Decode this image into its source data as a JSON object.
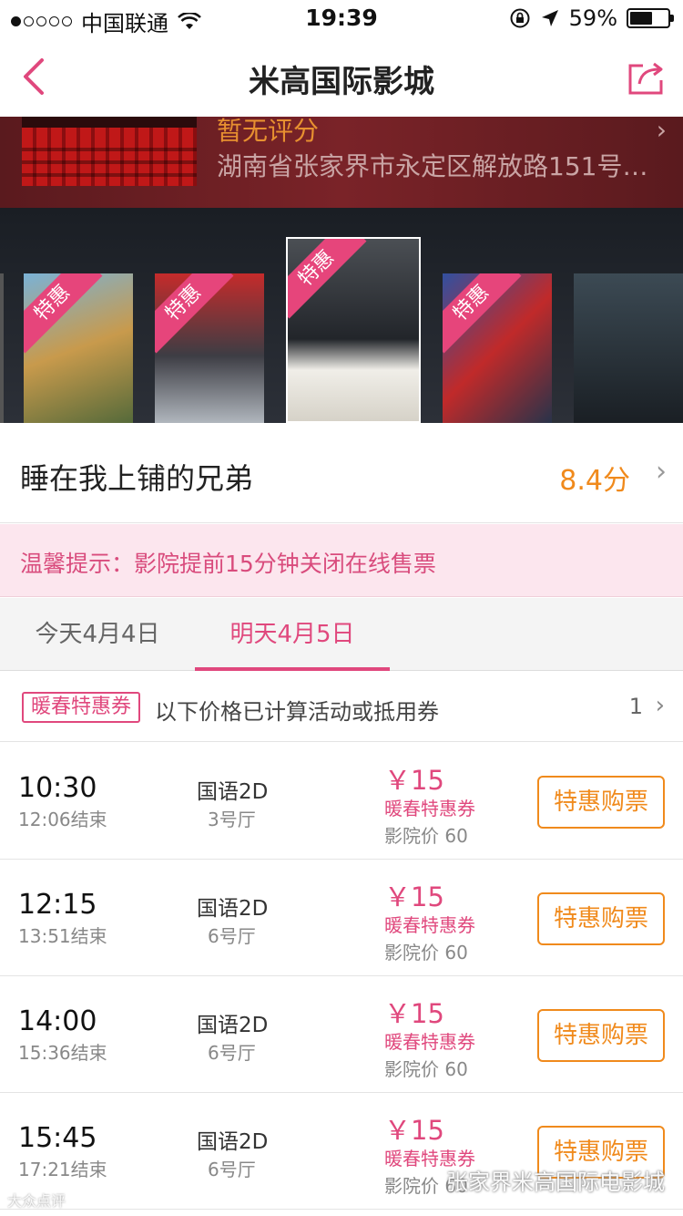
{
  "status_bar": {
    "carrier": "中国联通",
    "time": "19:39",
    "battery": "59%",
    "battery_level": 0.59
  },
  "nav": {
    "title": "米高国际影城",
    "back_icon": "chevron-left-icon",
    "share_icon": "share-icon"
  },
  "cinema": {
    "rating": "暂无评分",
    "address": "湖南省张家界市永定区解放路151号…",
    "chevron": "›"
  },
  "posters": {
    "badge": "特惠"
  },
  "movie": {
    "name": "睡在我上铺的兄弟",
    "score": "8.4分",
    "chevron": "›"
  },
  "notice": "温馨提示：影院提前15分钟关闭在线售票",
  "tabs": [
    {
      "label": "今天4月4日"
    },
    {
      "label": "明天4月5日"
    }
  ],
  "promo": {
    "tag": "暖春特惠券",
    "text": "以下价格已计算活动或抵用券",
    "count": "1",
    "chevron": "›"
  },
  "showtimes": [
    {
      "start": "10:30",
      "end": "12:06结束",
      "lang": "国语2D",
      "hall": "3号厅",
      "price": "￥15",
      "coupon": "暖春特惠券",
      "orig": "影院价  60",
      "buy": "特惠购票"
    },
    {
      "start": "12:15",
      "end": "13:51结束",
      "lang": "国语2D",
      "hall": "6号厅",
      "price": "￥15",
      "coupon": "暖春特惠券",
      "orig": "影院价  60",
      "buy": "特惠购票"
    },
    {
      "start": "14:00",
      "end": "15:36结束",
      "lang": "国语2D",
      "hall": "6号厅",
      "price": "￥15",
      "coupon": "暖春特惠券",
      "orig": "影院价  60",
      "buy": "特惠购票"
    },
    {
      "start": "15:45",
      "end": "17:21结束",
      "lang": "国语2D",
      "hall": "6号厅",
      "price": "￥15",
      "coupon": "暖春特惠券",
      "orig": "影院价  60",
      "buy": "特惠购票"
    }
  ],
  "watermark": "张家界米高国际电影城",
  "watermark_left": "大众点评",
  "colors": {
    "accent": "#e0487d",
    "orange": "#f08a1c"
  }
}
